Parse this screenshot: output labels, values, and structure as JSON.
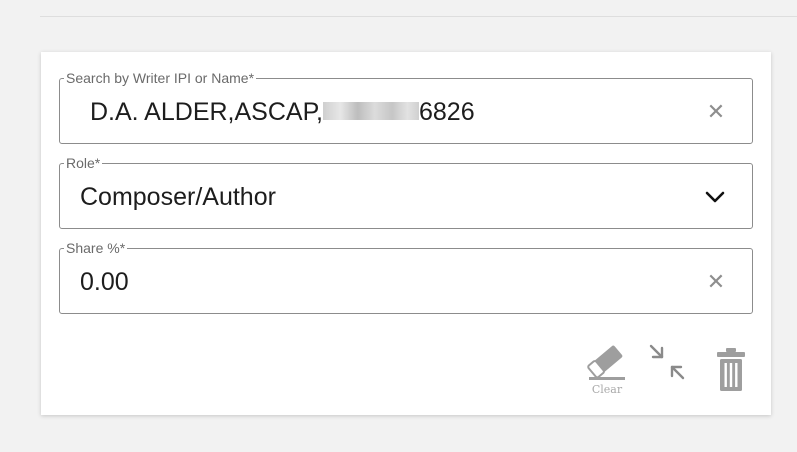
{
  "form": {
    "writer": {
      "label": "Search by Writer IPI or Name*",
      "value_prefix": "D.A. ALDER,ASCAP,",
      "value_suffix": "6826"
    },
    "role": {
      "label": "Role*",
      "value": "Composer/Author"
    },
    "share": {
      "label": "Share %*",
      "value": "0.00"
    }
  },
  "actions": {
    "clear_label": "Clear"
  },
  "icons": {
    "clear": "close-icon",
    "dropdown": "chevron-down-icon",
    "eraser": "eraser-icon",
    "collapse": "collapse-icon",
    "trash": "trash-icon"
  }
}
